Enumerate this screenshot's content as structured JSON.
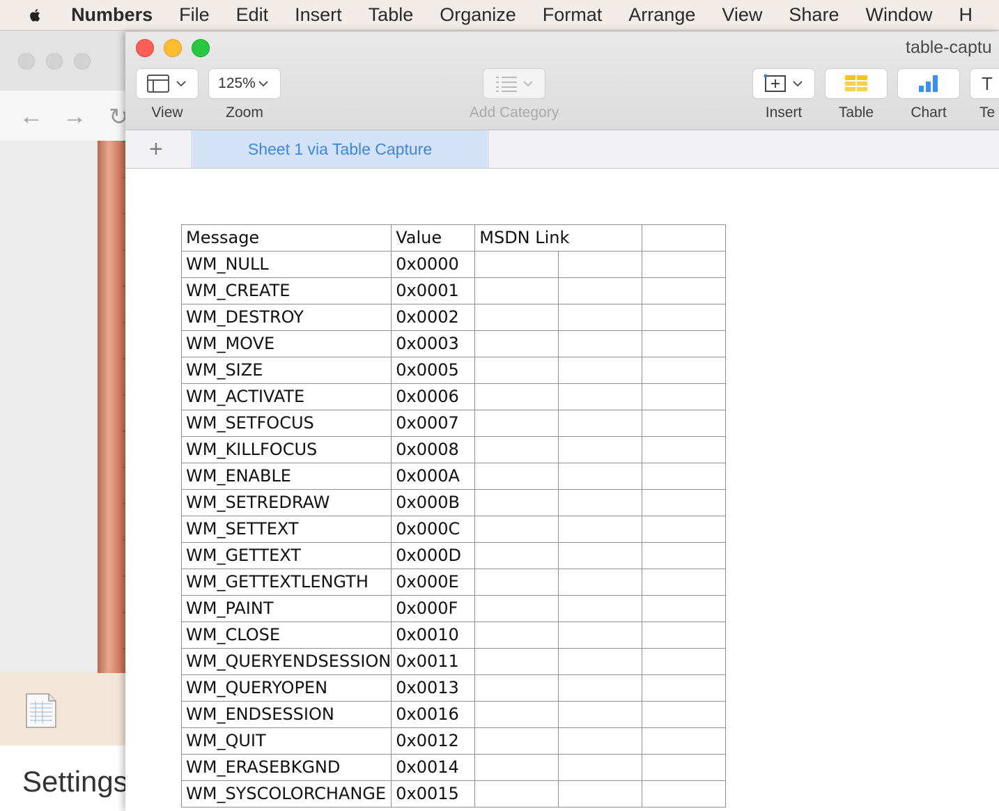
{
  "menubar": {
    "app_name": "Numbers",
    "items": [
      "File",
      "Edit",
      "Insert",
      "Table",
      "Organize",
      "Format",
      "Arrange",
      "View",
      "Share",
      "Window",
      "H"
    ]
  },
  "background_window": {
    "settings_label": "Settings"
  },
  "window": {
    "title": "table-captu"
  },
  "toolbar": {
    "view_label": "View",
    "zoom_value": "125%",
    "zoom_label": "Zoom",
    "add_category_label": "Add Category",
    "insert_label": "Insert",
    "table_label": "Table",
    "chart_label": "Chart",
    "text_label": "Te"
  },
  "sheets": {
    "add_symbol": "+",
    "active_tab": "Sheet 1 via Table Capture"
  },
  "table": {
    "headers": [
      "Message",
      "Value",
      "MSDN Link",
      ""
    ],
    "rows": [
      [
        "WM_NULL",
        "0x0000"
      ],
      [
        "WM_CREATE",
        "0x0001"
      ],
      [
        "WM_DESTROY",
        "0x0002"
      ],
      [
        "WM_MOVE",
        "0x0003"
      ],
      [
        "WM_SIZE",
        "0x0005"
      ],
      [
        "WM_ACTIVATE",
        "0x0006"
      ],
      [
        "WM_SETFOCUS",
        "0x0007"
      ],
      [
        "WM_KILLFOCUS",
        "0x0008"
      ],
      [
        "WM_ENABLE",
        "0x000A"
      ],
      [
        "WM_SETREDRAW",
        "0x000B"
      ],
      [
        "WM_SETTEXT",
        "0x000C"
      ],
      [
        "WM_GETTEXT",
        "0x000D"
      ],
      [
        "WM_GETTEXTLENGTH",
        "0x000E"
      ],
      [
        "WM_PAINT",
        "0x000F"
      ],
      [
        "WM_CLOSE",
        "0x0010"
      ],
      [
        "WM_QUERYENDSESSION",
        "0x0011"
      ],
      [
        "WM_QUERYOPEN",
        "0x0013"
      ],
      [
        "WM_ENDSESSION",
        "0x0016"
      ],
      [
        "WM_QUIT",
        "0x0012"
      ],
      [
        "WM_ERASEBKGND",
        "0x0014"
      ],
      [
        "WM_SYSCOLORCHANGE",
        "0x0015"
      ]
    ]
  }
}
